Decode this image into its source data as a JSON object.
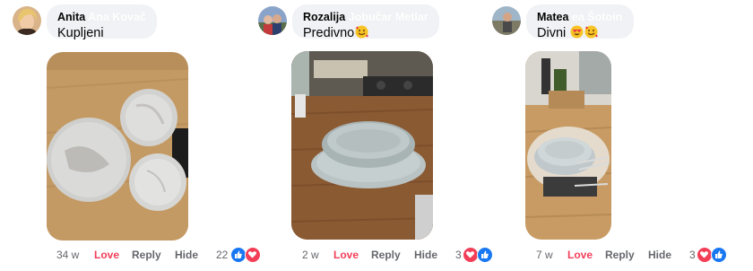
{
  "comments": [
    {
      "author": "Anita",
      "author_rest": "Ana Kovač",
      "text": "Kupljeni",
      "time": "34 w",
      "love": "Love",
      "reply": "Reply",
      "hide": "Hide",
      "reaction_count": "22",
      "reactions": [
        "like-icon",
        "heart-icon"
      ]
    },
    {
      "author": "Rozalija",
      "author_rest": "Jobučar Metlar",
      "text": "Predivno",
      "time": "2 w",
      "love": "Love",
      "reply": "Reply",
      "hide": "Hide",
      "reaction_count": "3",
      "reactions": [
        "heart-icon",
        "like-icon"
      ]
    },
    {
      "author": "Matea",
      "author_rest": "ea Šotoin",
      "text": "Divni",
      "time": "7 w",
      "love": "Love",
      "reply": "Reply",
      "hide": "Hide",
      "reaction_count": "3",
      "reactions": [
        "heart-icon",
        "like-icon"
      ]
    }
  ],
  "colors": {
    "love": "#f33e58",
    "like": "#1877f2",
    "bubble": "#f0f2f5",
    "meta": "#65676b"
  }
}
